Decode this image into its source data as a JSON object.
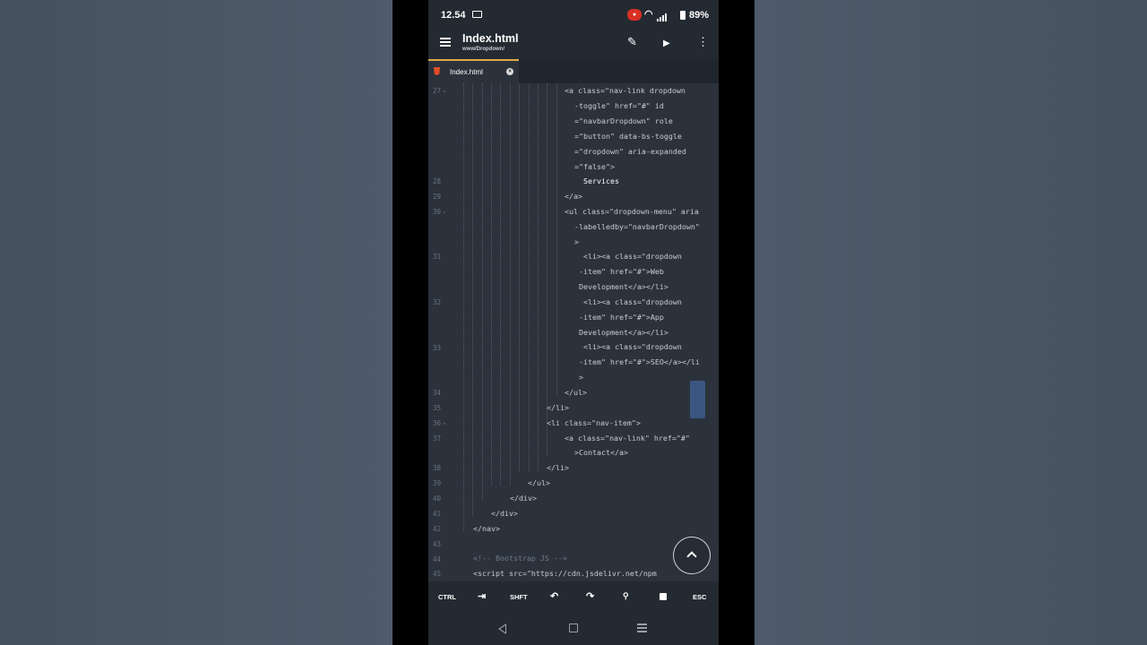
{
  "status": {
    "time": "12.54",
    "battery": "89%"
  },
  "appbar": {
    "title": "Index.html",
    "subtitle": "www/Dropdown/"
  },
  "tab": {
    "label": "Index.html"
  },
  "editor": {
    "line_numbers": [
      "27",
      "28",
      "29",
      "30",
      "31",
      "32",
      "33",
      "34",
      "35",
      "36",
      "37",
      "38",
      "39",
      "40",
      "41",
      "42",
      "43",
      "44",
      "45"
    ],
    "lines": [
      "<a class=\"nav-link dropdown",
      "-toggle\" href=\"#\" id",
      "=\"navbarDropdown\" role",
      "=\"button\" data-bs-toggle",
      "=\"dropdown\" aria-expanded",
      "=\"false\">",
      "Services",
      "</a>",
      "<ul class=\"dropdown-menu\" aria",
      "-labelledby=\"navbarDropdown\"",
      ">",
      "<li><a class=\"dropdown",
      "-item\" href=\"#\">Web",
      "Development</a></li>",
      "<li><a class=\"dropdown",
      "-item\" href=\"#\">App",
      "Development</a></li>",
      "<li><a class=\"dropdown",
      "-item\" href=\"#\">SEO</a></li",
      ">",
      "</ul>",
      "</li>",
      "<li class=\"nav-item\">",
      "<a class=\"nav-link\" href=\"#\"",
      ">Contact</a>",
      "</li>",
      "</ul>",
      "</div>",
      "</div>",
      "</nav>",
      "",
      "<!-- Bootstrap JS -->",
      "<script src=\"https://cdn.jsdelivr.net/npm"
    ]
  },
  "toolbar": {
    "ctrl": "CTRL",
    "shift": "SHFT",
    "esc": "ESC"
  },
  "icons": {
    "menu": "hamburger-icon",
    "edit": "pencil-icon",
    "run": "play-icon",
    "more": "more-vert-icon",
    "tab": "tab-icon",
    "undo": "undo-icon",
    "redo": "redo-icon",
    "search": "search-icon",
    "save": "save-icon",
    "scroll_top": "chevron-up-icon"
  }
}
